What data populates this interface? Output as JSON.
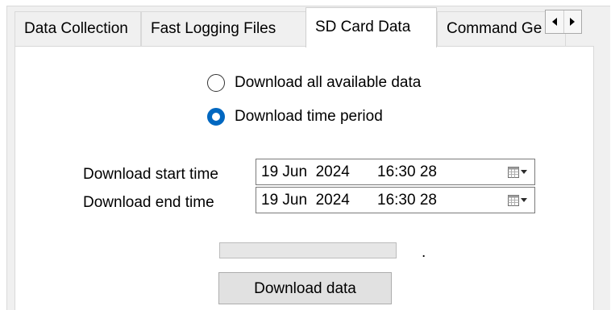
{
  "tabs": [
    {
      "label": "Data Collection",
      "selected": false
    },
    {
      "label": "Fast Logging Files",
      "selected": false
    },
    {
      "label": "SD Card Data",
      "selected": true
    },
    {
      "label": "Command Ge",
      "selected": false
    }
  ],
  "tab_scroll": {
    "left_icon": "triangle-left",
    "right_icon": "triangle-right"
  },
  "download_mode": {
    "options": [
      {
        "label": "Download all available data",
        "checked": false
      },
      {
        "label": "Download time period",
        "checked": true
      }
    ]
  },
  "start_time": {
    "label": "Download start time",
    "date": "19 Jun  2024",
    "time": "16:30 28",
    "calendar_icon": "calendar-dropdown"
  },
  "end_time": {
    "label": "Download end time",
    "date": "19 Jun  2024",
    "time": "16:30 28",
    "calendar_icon": "calendar-dropdown"
  },
  "progress": {
    "value": 0
  },
  "status_text": ".",
  "download_button": {
    "label": "Download data"
  },
  "colors": {
    "accent": "#0067c0",
    "panel_bg": "#ffffff",
    "frame_bg": "#f0f0f0",
    "button_bg": "#e1e1e1"
  }
}
